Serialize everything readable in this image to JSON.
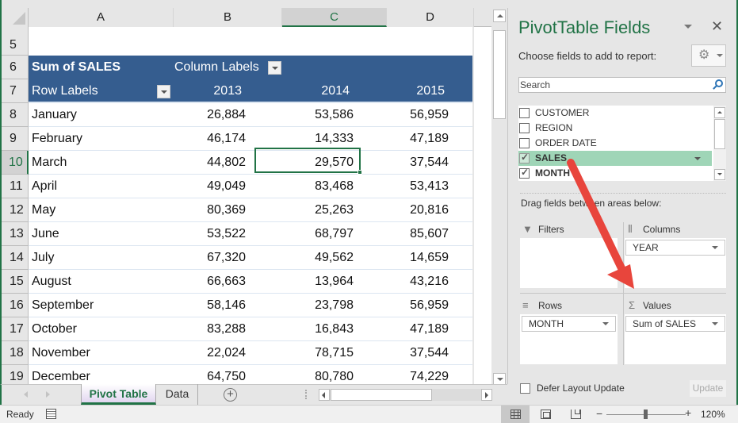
{
  "columns": [
    "A",
    "B",
    "C",
    "D"
  ],
  "active_column": "C",
  "row_numbers": [
    "5",
    "6",
    "7",
    "8",
    "9",
    "10",
    "11",
    "12",
    "13",
    "14",
    "15",
    "16",
    "17",
    "18",
    "19"
  ],
  "active_row": "10",
  "pivot": {
    "value_header": "Sum of SALES",
    "column_labels": "Column Labels",
    "row_labels": "Row Labels",
    "years": [
      "2013",
      "2014",
      "2015"
    ],
    "rows": [
      {
        "month": "January",
        "y2013": "26,884",
        "y2014": "53,586",
        "y2015": "56,959"
      },
      {
        "month": "February",
        "y2013": "46,174",
        "y2014": "14,333",
        "y2015": "47,189"
      },
      {
        "month": "March",
        "y2013": "44,802",
        "y2014": "29,570",
        "y2015": "37,544"
      },
      {
        "month": "April",
        "y2013": "49,049",
        "y2014": "83,468",
        "y2015": "53,413"
      },
      {
        "month": "May",
        "y2013": "80,369",
        "y2014": "25,263",
        "y2015": "20,816"
      },
      {
        "month": "June",
        "y2013": "53,522",
        "y2014": "68,797",
        "y2015": "85,607"
      },
      {
        "month": "July",
        "y2013": "67,320",
        "y2014": "49,562",
        "y2015": "14,659"
      },
      {
        "month": "August",
        "y2013": "66,663",
        "y2014": "13,964",
        "y2015": "43,216"
      },
      {
        "month": "September",
        "y2013": "58,146",
        "y2014": "23,798",
        "y2015": "56,959"
      },
      {
        "month": "October",
        "y2013": "83,288",
        "y2014": "16,843",
        "y2015": "47,189"
      },
      {
        "month": "November",
        "y2013": "22,024",
        "y2014": "78,715",
        "y2015": "37,544"
      },
      {
        "month": "December",
        "y2013": "64,750",
        "y2014": "80,780",
        "y2015": "74,229"
      }
    ],
    "selected_cell": "C10"
  },
  "sheets": {
    "active": "Pivot Table",
    "other": "Data",
    "add_icon": "+"
  },
  "status": {
    "ready": "Ready",
    "zoom_level": "120%",
    "zoom_minus": "−",
    "zoom_plus": "+"
  },
  "panel": {
    "title": "PivotTable Fields",
    "close_icon": "✕",
    "subtitle": "Choose fields to add to report:",
    "gear_icon": "⚙",
    "search_placeholder": "Search",
    "fields": [
      {
        "label": "CUSTOMER",
        "checked": false
      },
      {
        "label": "REGION",
        "checked": false
      },
      {
        "label": "ORDER DATE",
        "checked": false
      },
      {
        "label": "SALES",
        "checked": true,
        "highlighted": true
      },
      {
        "label": "MONTH",
        "checked": true
      }
    ],
    "drag_hint": "Drag fields between areas below:",
    "areas": {
      "filters": {
        "label": "Filters",
        "icon": "▼",
        "items": []
      },
      "columns": {
        "label": "Columns",
        "icon": "⦀",
        "items": [
          "YEAR"
        ]
      },
      "rows": {
        "label": "Rows",
        "icon": "≡",
        "items": [
          "MONTH"
        ]
      },
      "values": {
        "label": "Values",
        "icon": "Σ",
        "items": [
          "Sum of SALES"
        ]
      }
    },
    "defer_label": "Defer Layout Update",
    "defer_checked": false,
    "update_label": "Update"
  },
  "annotation": {
    "type": "arrow",
    "color": "#e8453c",
    "from": "SALES field",
    "to": "Values area"
  }
}
